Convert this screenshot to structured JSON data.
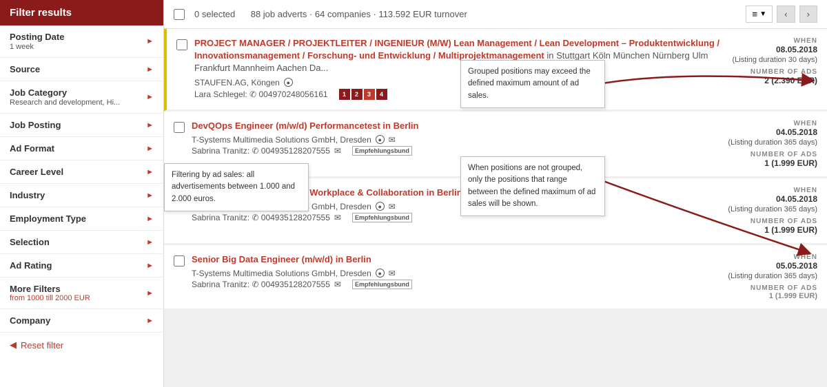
{
  "sidebar": {
    "title": "Filter results",
    "filters": [
      {
        "id": "posting-date",
        "label": "Posting Date",
        "sub": "1 week",
        "has_arrow": true
      },
      {
        "id": "source",
        "label": "Source",
        "sub": "",
        "has_arrow": true
      },
      {
        "id": "job-category",
        "label": "Job Category",
        "sub": "Research and development, Hi...",
        "has_arrow": true
      },
      {
        "id": "job-posting",
        "label": "Job Posting",
        "sub": "",
        "has_arrow": true
      },
      {
        "id": "ad-format",
        "label": "Ad Format",
        "sub": "",
        "has_arrow": true
      },
      {
        "id": "career-level",
        "label": "Career Level",
        "sub": "",
        "has_arrow": true
      },
      {
        "id": "industry",
        "label": "Industry",
        "sub": "",
        "has_arrow": true
      },
      {
        "id": "employment-type",
        "label": "Employment Type",
        "sub": "",
        "has_arrow": true
      },
      {
        "id": "selection",
        "label": "Selection",
        "sub": "",
        "has_arrow": true
      },
      {
        "id": "ad-rating",
        "label": "Ad Rating",
        "sub": "",
        "has_arrow": true
      }
    ],
    "more_filters": {
      "label": "More Filters",
      "sub": "from 1000 till 2000 EUR",
      "has_arrow": true
    },
    "company": {
      "label": "Company",
      "has_arrow": true
    },
    "reset": "Reset filter",
    "tooltip_adfilter": "Filtering by ad sales: all advertisements between 1.000 and 2.000 euros."
  },
  "topbar": {
    "selected_count": "0 selected",
    "stats": "88 job adverts  ·  64 companies  ·  113.592 EUR turnover",
    "menu_icon": "≡",
    "prev_icon": "‹",
    "next_icon": "›"
  },
  "callout1": {
    "text": "Grouped positions may exceed the defined maximum amount of ad sales."
  },
  "callout2": {
    "text": "When positions are not grouped, only the positions that range between the defined maximum of ad sales will be shown."
  },
  "jobs": [
    {
      "id": "job1",
      "title": "PROJECT MANAGER / PROJEKTLEITER / INGENIEUR (M/W) Lean Management / Lean Development – Produktentwicklung / Innovationsmanagement / Forschung- und Entwicklung / Multiprojektmanagement",
      "location": "in Stuttgart Köln München Nürnberg Ulm Frankfurt Mannheim Aachen Da...",
      "company": "STAUFEN.AG, Köngen",
      "contact": "Lara Schlegel: ✆ 004970248056161",
      "has_globe": true,
      "has_grouped": true,
      "when_label": "WHEN",
      "when_date": "08.05.2018",
      "duration": "(Listing duration 30 days)",
      "num_ads_label": "Number of ads",
      "num_ads": "2 (2.390 EUR)"
    },
    {
      "id": "job2",
      "title": "DevQOps Engineer (m/w/d) Performancetest in Berlin",
      "location": "in Berlin",
      "company": "T-Systems Multimedia Solutions GmbH, Dresden",
      "contact": "Sabrina Tranitz: ✆ 004935128207555",
      "has_globe": true,
      "has_mail": true,
      "has_empfehlung": true,
      "when_label": "WHEN",
      "when_date": "04.05.2018",
      "duration": "(Listing duration 365 days)",
      "num_ads_label": "Number of ads",
      "num_ads": "1 (1.999 EUR)"
    },
    {
      "id": "job3",
      "title": "Projektleiter (m/w/d) Digital Workplace & Collaboration in Berlin",
      "location": "in Berlin",
      "company": "T-Systems Multimedia Solutions GmbH, Dresden",
      "contact": "Sabrina Tranitz: ✆ 004935128207555",
      "has_globe": true,
      "has_mail": true,
      "has_empfehlung": true,
      "when_label": "WHEN",
      "when_date": "04.05.2018",
      "duration": "(Listing duration 365 days)",
      "num_ads_label": "Number of ads",
      "num_ads": "1 (1.999 EUR)"
    },
    {
      "id": "job4",
      "title": "Senior Big Data Engineer (m/w/d) in Berlin",
      "location": "in Berlin",
      "company": "T-Systems Multimedia Solutions GmbH, Dresden",
      "contact": "Sabrina Tranitz: ✆ 004935128207555",
      "has_globe": true,
      "has_mail": true,
      "has_empfehlung": true,
      "when_label": "WHEN",
      "when_date": "05.05.2018",
      "duration": "(Listing duration 365 days)",
      "num_ads_label": "Number of ads",
      "num_ads": "1 (1.999 EUR)"
    }
  ]
}
